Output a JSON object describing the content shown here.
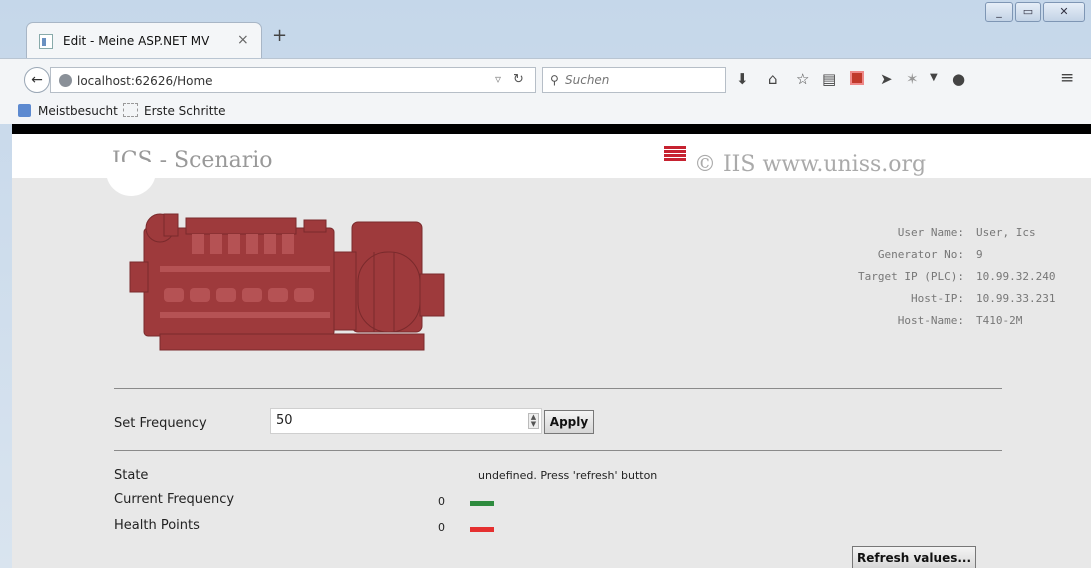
{
  "browser": {
    "tab_title": "Edit - Meine ASP.NET MV",
    "tab_close": "×",
    "new_tab": "+",
    "url": "localhost:62626/Home",
    "search_placeholder": "Suchen",
    "bookmarks": [
      "Meistbesucht",
      "Erste Schritte"
    ],
    "toolbar_icons": [
      "download-icon",
      "home-icon",
      "star-icon",
      "reading-list-icon",
      "addon-icon",
      "send-icon",
      "pocket-icon",
      "dropdown-icon",
      "chat-icon",
      "menu-icon"
    ]
  },
  "page": {
    "site_title": "ICS - Scenario",
    "copyright": "© IIS www.uniss.org",
    "info": [
      {
        "label": "User Name:",
        "value": "User, Ics"
      },
      {
        "label": "Generator No:",
        "value": "9"
      },
      {
        "label": "Target IP (PLC):",
        "value": "10.99.32.240"
      },
      {
        "label": "Host-IP:",
        "value": "10.99.33.231"
      },
      {
        "label": "Host-Name:",
        "value": "T410-2M"
      }
    ],
    "set_frequency_label": "Set Frequency",
    "frequency_value": "50",
    "apply_label": "Apply",
    "state_label": "State",
    "state_value": "undefined. Press 'refresh' button",
    "current_frequency_label": "Current Frequency",
    "current_frequency_value": "0",
    "health_points_label": "Health Points",
    "health_points_value": "0",
    "refresh_label": "Refresh values...",
    "colors": {
      "ok_bar": "#2e8b3e",
      "alert_bar": "#e53030",
      "engine": "#9e3a3c",
      "flag": "#c62230"
    }
  }
}
